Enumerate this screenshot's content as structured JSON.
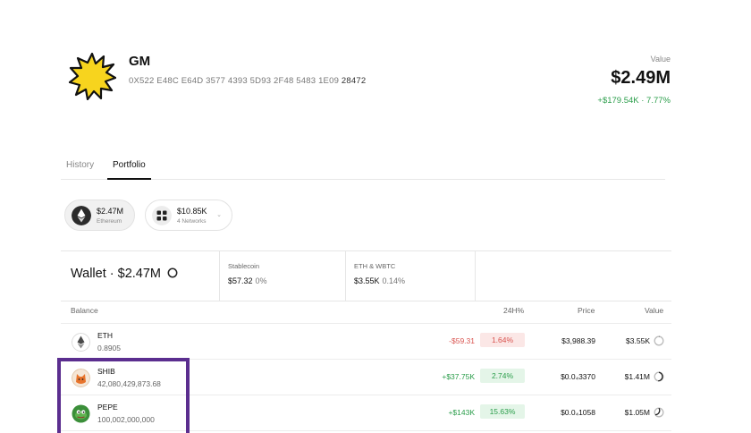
{
  "profile": {
    "name": "GM",
    "address_prefix": "0X522 E48C E64D 3577 4393 5D93 2F48 5483 1E09",
    "address_suffix": "28472"
  },
  "summary": {
    "label": "Value",
    "amount": "$2.49M",
    "change": "+$179.54K · 7.77%"
  },
  "tabs": [
    {
      "label": "History",
      "active": false
    },
    {
      "label": "Portfolio",
      "active": true
    }
  ],
  "networks": [
    {
      "amount": "$2.47M",
      "sub": "Ethereum",
      "icon": "ethereum-icon"
    },
    {
      "amount": "$10.85K",
      "sub": "4 Networks",
      "icon": "grid-icon",
      "caret": "⌄"
    }
  ],
  "wallet": {
    "title": "Wallet · $2.47M",
    "cells": [
      {
        "label": "Stablecoin",
        "value": "$57.32",
        "pct": "0%"
      },
      {
        "label": "ETH & WBTC",
        "value": "$3.55K",
        "pct": "0.14%"
      }
    ]
  },
  "table": {
    "headers": {
      "balance": "Balance",
      "change": "24H%",
      "price": "Price",
      "value": "Value"
    },
    "rows": [
      {
        "symbol": "ETH",
        "balance": "0.8905",
        "change": "-$59.31",
        "pct": "1.64%",
        "price": "$3,988.39",
        "value": "$3.55K",
        "direction": "neg",
        "icon": "eth-icon"
      },
      {
        "symbol": "SHIB",
        "balance": "42,080,429,873.68",
        "change": "+$37.75K",
        "pct": "2.74%",
        "price": "$0.0₄3370",
        "value": "$1.41M",
        "direction": "pos",
        "icon": "shib-icon"
      },
      {
        "symbol": "PEPE",
        "balance": "100,002,000,000",
        "change": "+$143K",
        "pct": "15.63%",
        "price": "$0.0₄1058",
        "value": "$1.05M",
        "direction": "pos",
        "icon": "pepe-icon"
      }
    ]
  },
  "colors": {
    "positive": "#2a9d4a",
    "negative": "#d9534f",
    "highlight": "#5b2e8f",
    "sun": "#f7d41e"
  }
}
